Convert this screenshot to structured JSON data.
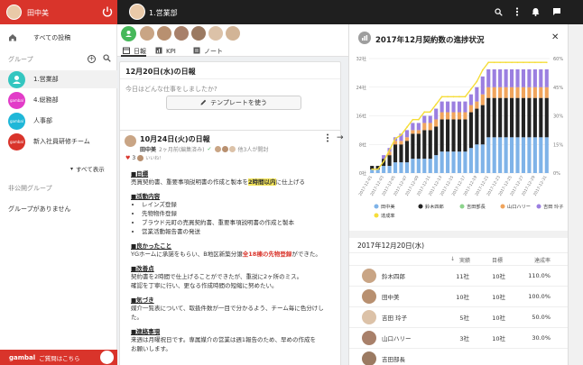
{
  "user": {
    "name": "田中美"
  },
  "sidebar": {
    "all_posts": "すべての投稿",
    "group_heading": "グループ",
    "groups": [
      {
        "label": "1.営業部",
        "color": "#34c6c0",
        "badge": ""
      },
      {
        "label": "4.総務部",
        "color": "#e23cc8",
        "badge": "gambal"
      },
      {
        "label": "人事部",
        "color": "#1fb7d8",
        "badge": "gambal"
      },
      {
        "label": "新入社員研修チーム",
        "color": "#d9342b",
        "badge": "gambal"
      }
    ],
    "show_all": "すべて表示",
    "private_heading": "非公開グループ",
    "no_groups": "グループがありません",
    "footer_brand": "gambal",
    "footer_text": "ご質問はこちら"
  },
  "topbar": {
    "group_name": "1.営業部"
  },
  "tabs": [
    {
      "label": "日報",
      "icon": "calendar-icon"
    },
    {
      "label": "KPI",
      "icon": "chart-icon"
    },
    {
      "label": "ノート",
      "icon": "note-icon"
    }
  ],
  "composer": {
    "date_title": "12月20日(水)の日報",
    "placeholder": "今日はどんな仕事をしましたか?",
    "template_button": "テンプレートを使う"
  },
  "post": {
    "title": "10月24日(火)の日報",
    "author": "田中美",
    "meta": "2ヶ月前(編集済み)",
    "readers": "他3人が開封",
    "reactions": "3",
    "reaction_extra": "いいね!",
    "s1_title": "■目標",
    "s1_body_pre": "売買契約書、重要事項説明書の作成と製本を",
    "s1_body_hl": "2時間以内",
    "s1_body_post": "に仕上げる",
    "s2_title": "■活動内容",
    "s2_items": [
      "レインズ登録",
      "先物物件登録",
      "ブラウド元町の売買契約書、重要事項説明書の作成と製本",
      "営業活動報告書の発送"
    ],
    "s3_title": "■良かったこと",
    "s3_body_pre": "YGホームに承諾をもらい、B地区新築分譲",
    "s3_body_red": "全18棟の先物登録",
    "s3_body_post": "ができた。",
    "s4_title": "■改善点",
    "s4_body1": "契約書を2時間で仕上げることができたが、重説に2ヶ所のミス。",
    "s4_body2": "確認を丁寧に行い、更なる作成時間の短縮に努めたい。",
    "s5_title": "■気づき",
    "s5_body1": "媒介一覧表について、取扱件数が一目で分かるよう、チーム毎に色分けし",
    "s5_body2": "た。",
    "s6_title": "■連絡事項",
    "s6_body1": "来週は月曜祝日です。専属媒介の営業は週1報告のため、早めの作成を",
    "s6_body2": "お願いします。"
  },
  "panel": {
    "title": "2017年12月契約数の進捗状況",
    "table_date": "2017年12月20日(水)",
    "col_actual": "実績",
    "col_target": "目標",
    "col_rate": "達成率",
    "rows": [
      {
        "name": "鈴木四郎",
        "actual": "11社",
        "target": "10社",
        "rate": "110.0%"
      },
      {
        "name": "田中美",
        "actual": "10社",
        "target": "10社",
        "rate": "100.0%"
      },
      {
        "name": "吉田 玲子",
        "actual": "5社",
        "target": "10社",
        "rate": "50.0%"
      },
      {
        "name": "山口ハリー",
        "actual": "3社",
        "target": "10社",
        "rate": "30.0%"
      },
      {
        "name": "吉田部長",
        "actual": "",
        "target": "",
        "rate": ""
      }
    ]
  },
  "chart_data": {
    "type": "bar",
    "title": "2017年12月契約数の進捗状況",
    "x": [
      "2017-12-01",
      "2017-12-02",
      "2017-12-03",
      "2017-12-04",
      "2017-12-05",
      "2017-12-06",
      "2017-12-07",
      "2017-12-08",
      "2017-12-09",
      "2017-12-10",
      "2017-12-11",
      "2017-12-12",
      "2017-12-13",
      "2017-12-14",
      "2017-12-15",
      "2017-12-16",
      "2017-12-17",
      "2017-12-18",
      "2017-12-19",
      "2017-12-20",
      "2017-12-21",
      "2017-12-22",
      "2017-12-23",
      "2017-12-24",
      "2017-12-25",
      "2017-12-26",
      "2017-12-27",
      "2017-12-28",
      "2017-12-29",
      "2017-12-30",
      "2017-12-31"
    ],
    "x_tick_labels": [
      "2017-12-01",
      "2017-12-03",
      "2017-12-05",
      "2017-12-07",
      "2017-12-09",
      "2017-12-11",
      "2017-12-13",
      "2017-12-15",
      "2017-12-17",
      "2017-12-19",
      "2017-12-21",
      "2017-12-23",
      "2017-12-25",
      "2017-12-27",
      "2017-12-29",
      "2017-12-31"
    ],
    "y_left_ticks": [
      "0社",
      "8社",
      "16社",
      "24社",
      "32社"
    ],
    "y_right_ticks": [
      "0%",
      "15%",
      "30%",
      "45%",
      "60%"
    ],
    "ylim": [
      0,
      32
    ],
    "y2lim": [
      0,
      60
    ],
    "series": [
      {
        "name": "田中美",
        "color": "#7fb3e8",
        "values": [
          1,
          1,
          2,
          2,
          3,
          3,
          3,
          4,
          4,
          4,
          4,
          5,
          6,
          6,
          6,
          6,
          6,
          7,
          8,
          8,
          10,
          10,
          10,
          10,
          10,
          10,
          10,
          10,
          10,
          10,
          10
        ]
      },
      {
        "name": "鈴木四郎",
        "color": "#222222",
        "values": [
          1,
          1,
          2,
          3,
          5,
          5,
          6,
          7,
          7,
          8,
          8,
          8,
          9,
          9,
          9,
          9,
          9,
          10,
          10,
          11,
          11,
          11,
          11,
          11,
          11,
          11,
          11,
          11,
          11,
          11,
          11
        ]
      },
      {
        "name": "吉田部長",
        "color": "#8cd48c",
        "values": [
          0,
          0,
          0,
          0,
          0,
          0,
          0,
          0,
          0,
          0,
          0,
          0,
          0,
          0,
          0,
          0,
          0,
          0,
          0,
          0,
          0,
          0,
          0,
          0,
          0,
          0,
          0,
          0,
          0,
          0,
          0
        ]
      },
      {
        "name": "山口ハリー",
        "color": "#f0a45c",
        "values": [
          0,
          0,
          0,
          1,
          1,
          1,
          1,
          1,
          1,
          2,
          2,
          2,
          2,
          2,
          2,
          2,
          2,
          2,
          2,
          3,
          3,
          3,
          3,
          3,
          3,
          3,
          3,
          3,
          3,
          3,
          3
        ]
      },
      {
        "name": "吉田 玲子",
        "color": "#9b7fe0",
        "values": [
          0,
          0,
          1,
          1,
          1,
          2,
          2,
          2,
          2,
          2,
          2,
          3,
          3,
          3,
          3,
          3,
          3,
          3,
          4,
          5,
          5,
          5,
          5,
          5,
          5,
          5,
          5,
          5,
          5,
          5,
          5
        ]
      },
      {
        "name": "達成率",
        "type": "line",
        "color": "#f5dd3a",
        "values": [
          2,
          2,
          6,
          12,
          18,
          20,
          24,
          28,
          28,
          32,
          32,
          36,
          40,
          40,
          40,
          40,
          40,
          44,
          48,
          54,
          58,
          58,
          58,
          58,
          58,
          58,
          58,
          58,
          58,
          58,
          58
        ]
      }
    ]
  }
}
